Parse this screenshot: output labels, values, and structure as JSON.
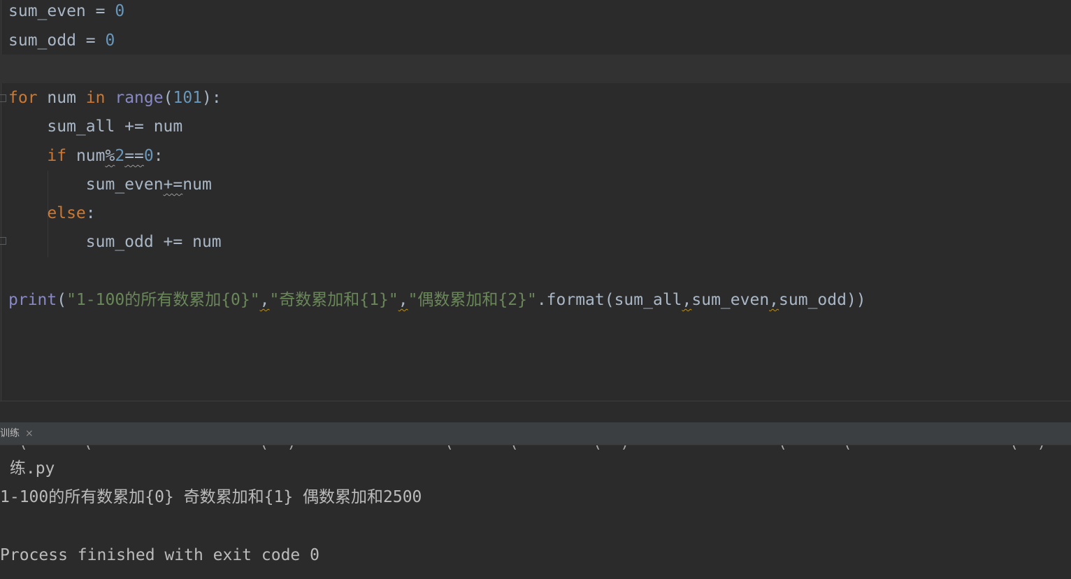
{
  "editor": {
    "lines": {
      "l1": {
        "name": "sum_even",
        "op": " = ",
        "val": "0"
      },
      "l2": {
        "name": "sum_odd",
        "op": " = ",
        "val": "0"
      },
      "l4": {
        "kw_for": "for",
        "a": " num ",
        "kw_in": "in",
        "sp": " ",
        "bi_range": "range",
        "p1": "(",
        "n": "101",
        "p2": "):"
      },
      "l5": {
        "text": "    sum_all += num"
      },
      "l6": {
        "kw_if": "if",
        "a": " num",
        "op1": "%",
        "n2": "2",
        "op2": "==",
        "n0": "0",
        "colon": ":"
      },
      "l7": {
        "a": "        sum_even",
        "op": "+=",
        "b": "num"
      },
      "l8": {
        "kw_else": "else",
        "colon": ":"
      },
      "l9": {
        "text": "        sum_odd += num"
      },
      "l11": {
        "bi_print": "print",
        "p1": "(",
        "s1": "\"1-100的所有数累加{0}\"",
        "c1": ",",
        "s2": "\"奇数累加和{1}\"",
        "c2": ",",
        "s3": "\"偶数累加和{2}\"",
        "fmt": ".format(sum_all",
        "c3": ",",
        "a2": "sum_even",
        "c4": ",",
        "a3": "sum_odd))"
      }
    }
  },
  "run_panel": {
    "tab_label": "训练",
    "close_glyph": "×"
  },
  "console": {
    "cut_line": "  (      (                  (  )                (      (        (  )                (      (                 (  )",
    "lines": [
      " 练.py",
      "1-100的所有数累加{0} 奇数累加和{1} 偶数累加和2500",
      "",
      "Process finished with exit code 0"
    ]
  }
}
